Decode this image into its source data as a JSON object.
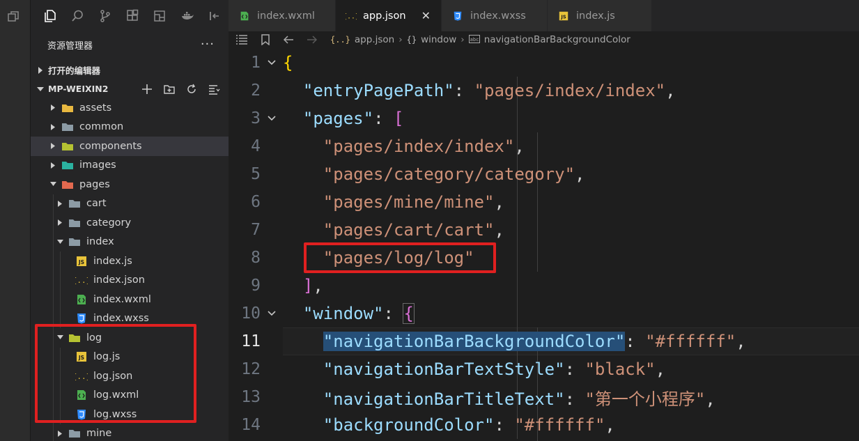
{
  "sidebar": {
    "explorer_title": "资源管理器",
    "more_label": "···",
    "open_editors_label": "打开的编辑器",
    "project_label": "MP-WEIXIN2"
  },
  "tree": [
    {
      "label": "assets",
      "type": "folder",
      "color": "#e8b840",
      "depth": 0,
      "expanded": false
    },
    {
      "label": "common",
      "type": "folder",
      "color": "#8c9ba5",
      "depth": 0,
      "expanded": false
    },
    {
      "label": "components",
      "type": "folder",
      "color": "#b5c232",
      "depth": 0,
      "expanded": false,
      "selected": true
    },
    {
      "label": "images",
      "type": "folder",
      "color": "#2bb2a0",
      "depth": 0,
      "expanded": false
    },
    {
      "label": "pages",
      "type": "folder",
      "color": "#e2694f",
      "depth": 0,
      "expanded": true
    },
    {
      "label": "cart",
      "type": "folder",
      "color": "#8c9ba5",
      "depth": 1,
      "expanded": false
    },
    {
      "label": "category",
      "type": "folder",
      "color": "#8c9ba5",
      "depth": 1,
      "expanded": false
    },
    {
      "label": "index",
      "type": "folder",
      "color": "#8c9ba5",
      "depth": 1,
      "expanded": true
    },
    {
      "label": "index.js",
      "type": "js",
      "depth": 2
    },
    {
      "label": "index.json",
      "type": "json",
      "depth": 2
    },
    {
      "label": "index.wxml",
      "type": "wxml",
      "depth": 2
    },
    {
      "label": "index.wxss",
      "type": "wxss",
      "depth": 2
    },
    {
      "label": "log",
      "type": "folder",
      "color": "#b5c232",
      "depth": 1,
      "expanded": true
    },
    {
      "label": "log.js",
      "type": "js",
      "depth": 2
    },
    {
      "label": "log.json",
      "type": "json",
      "depth": 2
    },
    {
      "label": "log.wxml",
      "type": "wxml",
      "depth": 2
    },
    {
      "label": "log.wxss",
      "type": "wxss",
      "depth": 2
    },
    {
      "label": "mine",
      "type": "folder",
      "color": "#8c9ba5",
      "depth": 1,
      "expanded": false
    }
  ],
  "tabs": [
    {
      "label": "index.wxml",
      "type": "wxml",
      "active": false
    },
    {
      "label": "app.json",
      "type": "json",
      "active": true
    },
    {
      "label": "index.wxss",
      "type": "wxss",
      "active": false
    },
    {
      "label": "index.js",
      "type": "js",
      "active": false
    }
  ],
  "tab_close": "✕",
  "breadcrumb": {
    "json_icon": "{..}",
    "file": "app.json",
    "obj_icon": "{}",
    "object": "window",
    "str_icon": "abc",
    "property": "navigationBarBackgroundColor",
    "separator": "›"
  },
  "editor": {
    "current_line": 11,
    "lines": [
      {
        "n": "1"
      },
      {
        "n": "2"
      },
      {
        "n": "3"
      },
      {
        "n": "4"
      },
      {
        "n": "5"
      },
      {
        "n": "6"
      },
      {
        "n": "7"
      },
      {
        "n": "8"
      },
      {
        "n": "9"
      },
      {
        "n": "10"
      },
      {
        "n": "11"
      },
      {
        "n": "12"
      },
      {
        "n": "13"
      },
      {
        "n": "14"
      }
    ],
    "code": {
      "open_brace": "{",
      "entry_key": "\"entryPagePath\"",
      "entry_val": "\"pages/index/index\"",
      "pages_key": "\"pages\"",
      "open_bracket": "[",
      "page1": "\"pages/index/index\"",
      "page2": "\"pages/category/category\"",
      "page3": "\"pages/mine/mine\"",
      "page4": "\"pages/cart/cart\"",
      "page5": "\"pages/log/log\"",
      "close_bracket": "]",
      "window_key": "\"window\"",
      "window_brace": "{",
      "nbbc_key": "\"navigationBarBackgroundColor\"",
      "nbbc_val": "\"#ffffff\"",
      "nbts_key": "\"navigationBarTextStyle\"",
      "nbts_val": "\"black\"",
      "nbtt_key": "\"navigationBarTitleText\"",
      "nbtt_val": "\"第一个小程序\"",
      "bg_key": "\"backgroundColor\"",
      "bg_val": "\"#ffffff\"",
      "colon": ": ",
      "comma": ","
    }
  },
  "colors": {
    "key": "#9cdcfe",
    "string": "#ce9178",
    "highlight_box": "#e02020",
    "selection": "#264f78"
  }
}
